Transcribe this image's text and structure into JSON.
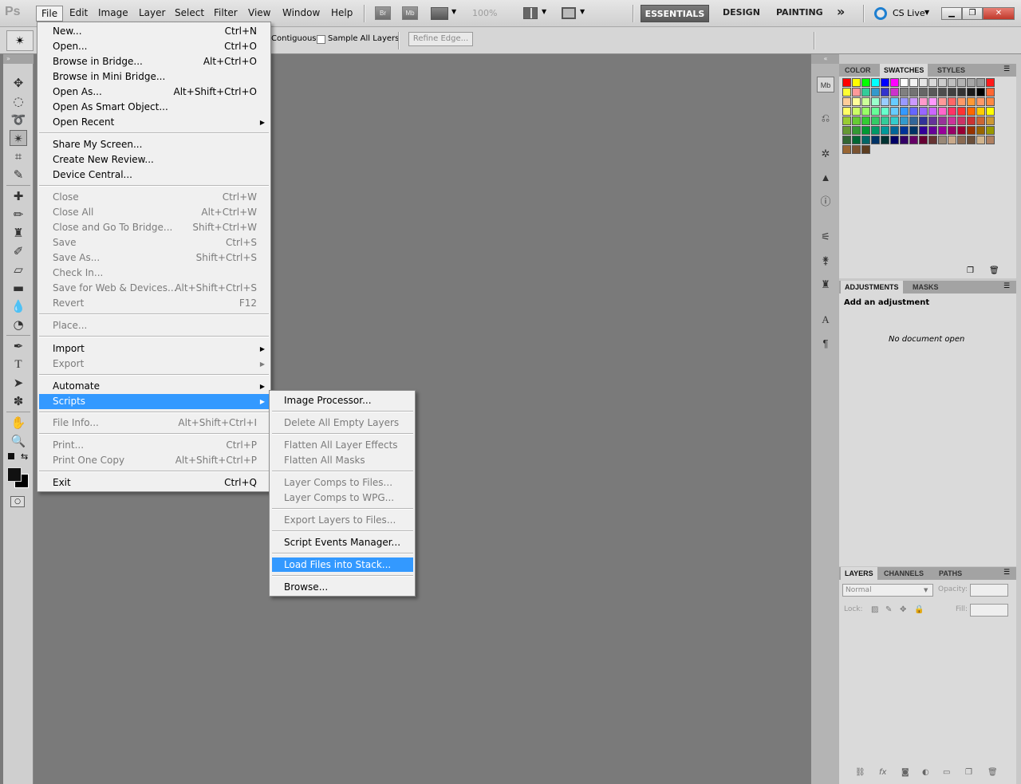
{
  "app": {
    "logo": "Ps"
  },
  "menubar": {
    "items": [
      "File",
      "Edit",
      "Image",
      "Layer",
      "Select",
      "Filter",
      "View",
      "Window",
      "Help"
    ],
    "bridge_btn": "Br",
    "minibridge_btn": "Mb",
    "zoom": "100%",
    "workspaces": [
      "ESSENTIALS",
      "DESIGN",
      "PAINTING"
    ],
    "more_label": "»",
    "cs_live": "CS Live"
  },
  "options": {
    "contiguous": "Contiguous",
    "sample_all_layers": "Sample All Layers",
    "refine_edge": "Refine Edge..."
  },
  "file_menu": {
    "new": {
      "label": "New...",
      "shortcut": "Ctrl+N"
    },
    "open": {
      "label": "Open...",
      "shortcut": "Ctrl+O"
    },
    "browse_bridge": {
      "label": "Browse in Bridge...",
      "shortcut": "Alt+Ctrl+O"
    },
    "browse_mini": {
      "label": "Browse in Mini Bridge...",
      "shortcut": ""
    },
    "open_as": {
      "label": "Open As...",
      "shortcut": "Alt+Shift+Ctrl+O"
    },
    "open_smart": {
      "label": "Open As Smart Object...",
      "shortcut": ""
    },
    "open_recent": {
      "label": "Open Recent",
      "shortcut": ""
    },
    "share_screen": {
      "label": "Share My Screen...",
      "shortcut": ""
    },
    "create_review": {
      "label": "Create New Review...",
      "shortcut": ""
    },
    "device_central": {
      "label": "Device Central...",
      "shortcut": ""
    },
    "close": {
      "label": "Close",
      "shortcut": "Ctrl+W"
    },
    "close_all": {
      "label": "Close All",
      "shortcut": "Alt+Ctrl+W"
    },
    "close_bridge": {
      "label": "Close and Go To Bridge...",
      "shortcut": "Shift+Ctrl+W"
    },
    "save": {
      "label": "Save",
      "shortcut": "Ctrl+S"
    },
    "save_as": {
      "label": "Save As...",
      "shortcut": "Shift+Ctrl+S"
    },
    "check_in": {
      "label": "Check In...",
      "shortcut": ""
    },
    "save_web": {
      "label": "Save for Web & Devices...",
      "shortcut": "Alt+Shift+Ctrl+S"
    },
    "revert": {
      "label": "Revert",
      "shortcut": "F12"
    },
    "place": {
      "label": "Place...",
      "shortcut": ""
    },
    "import": {
      "label": "Import",
      "shortcut": ""
    },
    "export": {
      "label": "Export",
      "shortcut": ""
    },
    "automate": {
      "label": "Automate",
      "shortcut": ""
    },
    "scripts": {
      "label": "Scripts",
      "shortcut": ""
    },
    "file_info": {
      "label": "File Info...",
      "shortcut": "Alt+Shift+Ctrl+I"
    },
    "print": {
      "label": "Print...",
      "shortcut": "Ctrl+P"
    },
    "print_one": {
      "label": "Print One Copy",
      "shortcut": "Alt+Shift+Ctrl+P"
    },
    "exit": {
      "label": "Exit",
      "shortcut": "Ctrl+Q"
    }
  },
  "scripts_menu": {
    "image_processor": "Image Processor...",
    "delete_empty": "Delete All Empty Layers",
    "flatten_effects": "Flatten All Layer Effects",
    "flatten_masks": "Flatten All Masks",
    "comps_files": "Layer Comps to Files...",
    "comps_wpg": "Layer Comps to WPG...",
    "export_layers": "Export Layers to Files...",
    "events_manager": "Script Events Manager...",
    "load_stack": "Load Files into Stack...",
    "browse": "Browse..."
  },
  "panels": {
    "color_tabs": [
      "COLOR",
      "SWATCHES",
      "STYLES"
    ],
    "adj_tabs": [
      "ADJUSTMENTS",
      "MASKS"
    ],
    "adj_title": "Add an adjustment",
    "no_doc": "No document open",
    "layer_tabs": [
      "LAYERS",
      "CHANNELS",
      "PATHS"
    ],
    "blend_mode": "Normal",
    "opacity_label": "Opacity:",
    "lock_label": "Lock:",
    "fill_label": "Fill:"
  },
  "swatch_colors": [
    [
      "#ff0000",
      "#ffff00",
      "#00ff00",
      "#00ffff",
      "#0000ff",
      "#ff00ff",
      "#ffffff",
      "#f2f2f2",
      "#e6e6e6",
      "#d9d9d9",
      "#cccccc",
      "#bfbfbf",
      "#b3b3b3",
      "#a6a6a6",
      "#999999",
      "#ff1a1a"
    ],
    [
      "#ffff33",
      "#ff9999",
      "#33cc99",
      "#3399cc",
      "#3333cc",
      "#cc33cc",
      "#808080",
      "#737373",
      "#666666",
      "#595959",
      "#4d4d4d",
      "#404040",
      "#333333",
      "#1a1a1a",
      "#000000",
      "#ff6633"
    ],
    [
      "#ffcc99",
      "#ffff99",
      "#ccff99",
      "#99ffcc",
      "#99ccff",
      "#66ccff",
      "#9999ff",
      "#cc99ff",
      "#ff99cc",
      "#ff99ff",
      "#ff9999",
      "#ff6666",
      "#ff9966",
      "#ff9933",
      "#ff9966",
      "#ff8844"
    ],
    [
      "#ffff66",
      "#ccff66",
      "#99ff66",
      "#66ff99",
      "#66ffcc",
      "#66ccff",
      "#3399ff",
      "#6666ff",
      "#9966ff",
      "#cc66ff",
      "#ff66cc",
      "#ff3366",
      "#ff3333",
      "#ff6600",
      "#ffcc00",
      "#ffff00"
    ],
    [
      "#99cc33",
      "#66cc33",
      "#33cc33",
      "#33cc66",
      "#33cc99",
      "#33cccc",
      "#3399cc",
      "#336699",
      "#333399",
      "#663399",
      "#993399",
      "#cc3399",
      "#cc3366",
      "#cc3333",
      "#cc6633",
      "#cc9933"
    ],
    [
      "#669933",
      "#339933",
      "#009933",
      "#009966",
      "#009999",
      "#006699",
      "#003399",
      "#003366",
      "#330099",
      "#660099",
      "#990099",
      "#990066",
      "#990033",
      "#993300",
      "#996600",
      "#999900"
    ],
    [
      "#336633",
      "#006633",
      "#006666",
      "#003366",
      "#003333",
      "#000066",
      "#330066",
      "#660066",
      "#660033",
      "#663333",
      "#998877",
      "#c9a98a",
      "#8b6b52",
      "#6b4f3a",
      "#d2b48c",
      "#b08060"
    ],
    [
      "#996633",
      "#7a5230",
      "#5c3d20"
    ]
  ]
}
